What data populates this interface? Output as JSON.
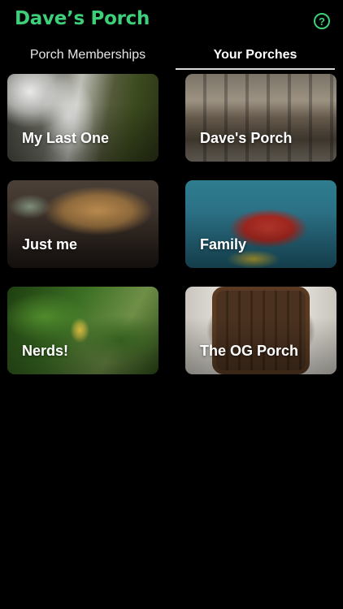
{
  "app": {
    "title": "Dave’s Porch",
    "accent_color": "#3ecf7a",
    "help_icon": "question-circle-icon",
    "help_glyph": "?"
  },
  "tabs": [
    {
      "label": "Porch Memberships",
      "selected": false
    },
    {
      "label": "Your Porches",
      "selected": true
    }
  ],
  "porches": [
    {
      "label": "My Last One",
      "image": "waterfall-photo"
    },
    {
      "label": "Dave's Porch",
      "image": "bar-stools-photo"
    },
    {
      "label": "Just me",
      "image": "sleeping-dog-photo"
    },
    {
      "label": "Family",
      "image": "lake-tube-photo"
    },
    {
      "label": "Nerds!",
      "image": "green-plant-photo"
    },
    {
      "label": "The OG Porch",
      "image": "wooden-porch-illustration"
    }
  ]
}
